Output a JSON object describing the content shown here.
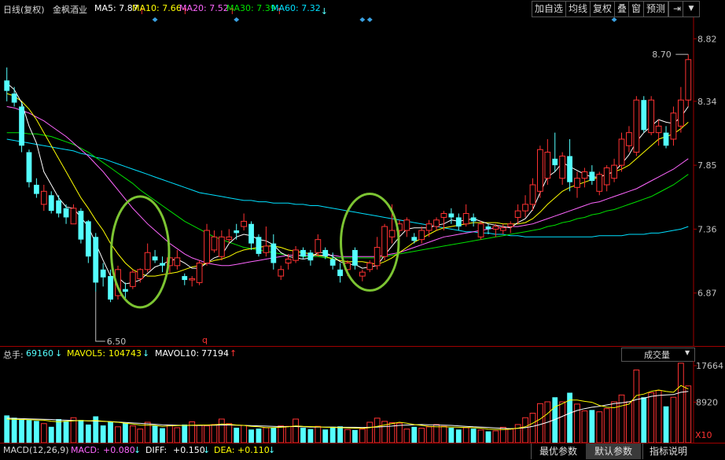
{
  "header": {
    "period": "日线(复权)",
    "stock": "金枫酒业",
    "ma": [
      {
        "label": "MA5",
        "value": "7.87",
        "arrow": "↑",
        "color": "#ffffff"
      },
      {
        "label": "MA10",
        "value": "7.66",
        "arrow": "↑",
        "color": "#ffff00"
      },
      {
        "label": "MA20",
        "value": "7.52",
        "arrow": "↑",
        "color": "#ff66ff"
      },
      {
        "label": "MA30",
        "value": "7.39",
        "arrow": "↑",
        "color": "#00e000"
      },
      {
        "label": "MA60",
        "value": "7.32",
        "arrow": "↓",
        "color": "#00e0ff"
      }
    ]
  },
  "toolbar": {
    "add_stock": "加自选",
    "ma_line": "均线",
    "restore": "复权",
    "overlay": "叠",
    "window": "窗",
    "alert": "预测",
    "exit_icon": "exit-icon",
    "menu_icon": "dropdown-icon"
  },
  "price_axis": {
    "ticks": [
      "8.82",
      "8.34",
      "7.85",
      "7.36",
      "6.87"
    ]
  },
  "annotations": {
    "high_label": "8.70",
    "low_label": "6.50",
    "q_marker": "q"
  },
  "volume_header": {
    "total_label": "总手:",
    "total_value": "69160",
    "total_arrow": "↓",
    "mavol5_label": "MAVOL5:",
    "mavol5_value": "104743",
    "mavol5_arrow": "↓",
    "mavol10_label": "MAVOL10:",
    "mavol10_value": "77194",
    "mavol10_arrow": "↑",
    "selector": "成交量"
  },
  "volume_axis": {
    "ticks": [
      "17664",
      "8920"
    ],
    "unit": "X10"
  },
  "macd_header": {
    "name": "MACD(12,26,9)",
    "macd_label": "MACD:",
    "macd_value": "+0.080",
    "macd_arrow": "↓",
    "diff_label": "DIFF:",
    "diff_value": "+0.150",
    "diff_arrow": "↓",
    "dea_label": "DEA:",
    "dea_value": "+0.110",
    "dea_arrow": "↓"
  },
  "bottom_buttons": [
    "最优参数",
    "默认参数",
    "指标说明"
  ],
  "colors": {
    "up": "#ff3232",
    "down": "#54ffff",
    "ma5": "#ffffff",
    "ma10": "#ffff00",
    "ma20": "#ff66ff",
    "ma30": "#00e000",
    "ma60": "#00e0ff",
    "circle": "#7cc432"
  },
  "chart_data": {
    "type": "candlestick",
    "ylim": [
      6.5,
      8.9
    ],
    "price_ticks": [
      8.82,
      8.34,
      7.85,
      7.36,
      6.87
    ],
    "candles": [
      [
        8.5,
        8.6,
        8.34,
        8.42
      ],
      [
        8.4,
        8.45,
        8.3,
        8.33
      ],
      [
        8.3,
        8.33,
        7.95,
        8.0
      ],
      [
        7.95,
        7.97,
        7.68,
        7.72
      ],
      [
        7.7,
        7.75,
        7.6,
        7.63
      ],
      [
        7.55,
        7.7,
        7.5,
        7.65
      ],
      [
        7.62,
        7.65,
        7.48,
        7.5
      ],
      [
        7.58,
        7.62,
        7.45,
        7.48
      ],
      [
        7.52,
        7.55,
        7.4,
        7.45
      ],
      [
        7.4,
        7.55,
        7.4,
        7.52
      ],
      [
        7.5,
        7.52,
        7.25,
        7.28
      ],
      [
        7.42,
        7.43,
        7.1,
        7.15
      ],
      [
        7.3,
        7.33,
        6.88,
        6.95
      ],
      [
        7.05,
        7.1,
        6.92,
        6.99
      ],
      [
        7.0,
        7.05,
        6.8,
        6.82
      ],
      [
        6.85,
        7.08,
        6.82,
        7.05
      ],
      [
        6.9,
        6.95,
        6.82,
        6.88
      ],
      [
        6.92,
        7.05,
        6.9,
        7.03
      ],
      [
        6.98,
        7.06,
        6.95,
        7.05
      ],
      [
        7.05,
        7.25,
        7.03,
        7.18
      ],
      [
        7.15,
        7.2,
        7.1,
        7.12
      ],
      [
        7.1,
        7.15,
        7.03,
        7.08
      ],
      [
        7.08,
        7.15,
        7.02,
        7.14
      ],
      [
        7.08,
        7.2,
        7.05,
        7.14
      ],
      [
        7.0,
        7.02,
        6.93,
        6.97
      ],
      [
        6.97,
        7.0,
        6.92,
        6.98
      ],
      [
        6.95,
        7.12,
        6.93,
        7.1
      ],
      [
        7.1,
        7.4,
        7.08,
        7.35
      ],
      [
        7.2,
        7.35,
        7.18,
        7.3
      ],
      [
        7.15,
        7.35,
        7.12,
        7.3
      ],
      [
        7.28,
        7.36,
        7.25,
        7.3
      ],
      [
        7.35,
        7.4,
        7.28,
        7.33
      ],
      [
        7.38,
        7.48,
        7.35,
        7.42
      ],
      [
        7.4,
        7.42,
        7.2,
        7.25
      ],
      [
        7.3,
        7.32,
        7.15,
        7.17
      ],
      [
        7.18,
        7.38,
        7.15,
        7.23
      ],
      [
        7.25,
        7.32,
        7.05,
        7.1
      ],
      [
        7.0,
        7.08,
        6.97,
        7.05
      ],
      [
        7.1,
        7.17,
        7.05,
        7.13
      ],
      [
        7.12,
        7.23,
        7.1,
        7.2
      ],
      [
        7.2,
        7.22,
        7.13,
        7.15
      ],
      [
        7.18,
        7.2,
        7.08,
        7.12
      ],
      [
        7.18,
        7.32,
        7.15,
        7.28
      ],
      [
        7.2,
        7.22,
        7.13,
        7.15
      ],
      [
        7.13,
        7.18,
        7.05,
        7.08
      ],
      [
        7.05,
        7.1,
        6.95,
        7.0
      ],
      [
        7.05,
        7.12,
        7.0,
        7.1
      ],
      [
        7.2,
        7.22,
        7.05,
        7.08
      ],
      [
        7.0,
        7.05,
        6.96,
        7.03
      ],
      [
        7.05,
        7.12,
        7.03,
        7.1
      ],
      [
        7.08,
        7.3,
        7.05,
        7.22
      ],
      [
        7.15,
        7.4,
        7.12,
        7.38
      ],
      [
        7.3,
        7.55,
        7.25,
        7.35
      ],
      [
        7.35,
        7.43,
        7.28,
        7.4
      ],
      [
        7.35,
        7.45,
        7.3,
        7.43
      ],
      [
        7.3,
        7.33,
        7.25,
        7.27
      ],
      [
        7.28,
        7.38,
        7.25,
        7.35
      ],
      [
        7.35,
        7.43,
        7.3,
        7.4
      ],
      [
        7.38,
        7.45,
        7.35,
        7.43
      ],
      [
        7.45,
        7.5,
        7.35,
        7.48
      ],
      [
        7.48,
        7.52,
        7.4,
        7.45
      ],
      [
        7.45,
        7.48,
        7.35,
        7.38
      ],
      [
        7.4,
        7.55,
        7.38,
        7.48
      ],
      [
        7.45,
        7.48,
        7.38,
        7.42
      ],
      [
        7.3,
        7.42,
        7.28,
        7.4
      ],
      [
        7.38,
        7.4,
        7.32,
        7.36
      ],
      [
        7.36,
        7.4,
        7.3,
        7.38
      ],
      [
        7.35,
        7.4,
        7.32,
        7.37
      ],
      [
        7.38,
        7.42,
        7.33,
        7.4
      ],
      [
        7.45,
        7.55,
        7.4,
        7.5
      ],
      [
        7.5,
        7.62,
        7.45,
        7.55
      ],
      [
        7.55,
        7.75,
        7.5,
        7.7
      ],
      [
        7.65,
        8.0,
        7.6,
        7.97
      ],
      [
        7.75,
        8.05,
        7.7,
        7.95
      ],
      [
        7.9,
        8.1,
        7.8,
        7.85
      ],
      [
        7.75,
        7.95,
        7.7,
        7.92
      ],
      [
        7.92,
        8.05,
        7.65,
        7.72
      ],
      [
        7.68,
        7.8,
        7.6,
        7.75
      ],
      [
        7.75,
        7.83,
        7.68,
        7.8
      ],
      [
        7.8,
        7.85,
        7.7,
        7.73
      ],
      [
        7.65,
        7.8,
        7.62,
        7.78
      ],
      [
        7.7,
        7.85,
        7.65,
        7.83
      ],
      [
        7.75,
        7.9,
        7.72,
        7.85
      ],
      [
        7.85,
        8.1,
        7.8,
        8.05
      ],
      [
        8.0,
        8.15,
        7.95,
        8.1
      ],
      [
        7.95,
        8.38,
        7.92,
        8.35
      ],
      [
        8.35,
        8.38,
        8.1,
        8.12
      ],
      [
        8.1,
        8.38,
        8.08,
        8.35
      ],
      [
        8.1,
        8.2,
        8.0,
        8.15
      ],
      [
        8.1,
        8.15,
        7.98,
        8.0
      ],
      [
        8.05,
        8.3,
        8.0,
        8.25
      ],
      [
        8.15,
        8.45,
        8.1,
        8.35
      ],
      [
        8.35,
        8.7,
        8.3,
        8.66
      ]
    ],
    "ma5": [
      8.48,
      8.43,
      8.33,
      8.15,
      8.02,
      7.8,
      7.7,
      7.6,
      7.53,
      7.52,
      7.45,
      7.38,
      7.25,
      7.12,
      7.0,
      6.99,
      6.94,
      6.95,
      6.97,
      7.02,
      7.07,
      7.09,
      7.12,
      7.13,
      7.1,
      7.06,
      7.06,
      7.1,
      7.14,
      7.16,
      7.25,
      7.3,
      7.32,
      7.31,
      7.28,
      7.27,
      7.24,
      7.18,
      7.15,
      7.14,
      7.13,
      7.14,
      7.18,
      7.18,
      7.15,
      7.11,
      7.09,
      7.09,
      7.06,
      7.07,
      7.08,
      7.16,
      7.23,
      7.3,
      7.36,
      7.37,
      7.37,
      7.37,
      7.39,
      7.4,
      7.43,
      7.42,
      7.43,
      7.44,
      7.42,
      7.4,
      7.39,
      7.38,
      7.37,
      7.41,
      7.44,
      7.51,
      7.64,
      7.76,
      7.8,
      7.87,
      7.84,
      7.81,
      7.78,
      7.76,
      7.76,
      7.78,
      7.8,
      7.86,
      7.93,
      8.03,
      8.1,
      8.15,
      8.2,
      8.18,
      8.17,
      8.22,
      8.3
    ],
    "ma10": [
      8.4,
      8.38,
      8.34,
      8.28,
      8.2,
      8.1,
      8.0,
      7.9,
      7.8,
      7.7,
      7.6,
      7.52,
      7.43,
      7.35,
      7.25,
      7.17,
      7.1,
      7.05,
      7.02,
      7.0,
      7.0,
      7.01,
      7.02,
      7.03,
      7.05,
      7.07,
      7.08,
      7.1,
      7.12,
      7.13,
      7.15,
      7.18,
      7.2,
      7.21,
      7.22,
      7.23,
      7.23,
      7.22,
      7.2,
      7.19,
      7.18,
      7.17,
      7.16,
      7.15,
      7.13,
      7.12,
      7.11,
      7.11,
      7.11,
      7.1,
      7.09,
      7.11,
      7.14,
      7.18,
      7.22,
      7.26,
      7.29,
      7.32,
      7.35,
      7.37,
      7.38,
      7.39,
      7.4,
      7.41,
      7.41,
      7.41,
      7.41,
      7.4,
      7.4,
      7.4,
      7.41,
      7.44,
      7.49,
      7.55,
      7.6,
      7.65,
      7.68,
      7.7,
      7.72,
      7.74,
      7.76,
      7.78,
      7.8,
      7.82,
      7.85,
      7.9,
      7.95,
      8.0,
      8.05,
      8.07,
      8.09,
      8.13,
      8.18
    ],
    "ma20": [
      8.3,
      8.29,
      8.27,
      8.25,
      8.22,
      8.19,
      8.15,
      8.11,
      8.07,
      8.02,
      7.97,
      7.92,
      7.86,
      7.8,
      7.73,
      7.66,
      7.59,
      7.52,
      7.46,
      7.4,
      7.35,
      7.3,
      7.25,
      7.21,
      7.17,
      7.14,
      7.12,
      7.1,
      7.09,
      7.08,
      7.08,
      7.09,
      7.1,
      7.11,
      7.12,
      7.13,
      7.14,
      7.15,
      7.16,
      7.16,
      7.16,
      7.16,
      7.16,
      7.16,
      7.16,
      7.15,
      7.15,
      7.15,
      7.15,
      7.15,
      7.15,
      7.16,
      7.17,
      7.18,
      7.2,
      7.22,
      7.24,
      7.26,
      7.28,
      7.3,
      7.31,
      7.32,
      7.33,
      7.34,
      7.35,
      7.36,
      7.37,
      7.37,
      7.38,
      7.38,
      7.39,
      7.4,
      7.42,
      7.44,
      7.46,
      7.48,
      7.5,
      7.52,
      7.54,
      7.56,
      7.57,
      7.59,
      7.61,
      7.63,
      7.65,
      7.67,
      7.7,
      7.73,
      7.76,
      7.79,
      7.82,
      7.86,
      7.9
    ],
    "ma30": [
      8.1,
      8.1,
      8.1,
      8.09,
      8.09,
      8.08,
      8.07,
      8.05,
      8.03,
      8.01,
      7.98,
      7.95,
      7.91,
      7.87,
      7.83,
      7.79,
      7.75,
      7.71,
      7.66,
      7.62,
      7.58,
      7.54,
      7.5,
      7.46,
      7.42,
      7.39,
      7.36,
      7.33,
      7.3,
      7.28,
      7.26,
      7.24,
      7.22,
      7.21,
      7.2,
      7.19,
      7.18,
      7.17,
      7.16,
      7.16,
      7.15,
      7.15,
      7.15,
      7.14,
      7.14,
      7.14,
      7.14,
      7.14,
      7.14,
      7.14,
      7.14,
      7.15,
      7.16,
      7.17,
      7.18,
      7.19,
      7.2,
      7.21,
      7.22,
      7.23,
      7.24,
      7.25,
      7.26,
      7.27,
      7.28,
      7.29,
      7.3,
      7.31,
      7.32,
      7.33,
      7.34,
      7.35,
      7.36,
      7.38,
      7.39,
      7.41,
      7.42,
      7.44,
      7.45,
      7.47,
      7.48,
      7.5,
      7.51,
      7.53,
      7.55,
      7.57,
      7.59,
      7.61,
      7.64,
      7.67,
      7.7,
      7.74,
      7.78
    ],
    "ma60": [
      8.05,
      8.04,
      8.03,
      8.02,
      8.01,
      8.0,
      7.99,
      7.98,
      7.97,
      7.96,
      7.94,
      7.93,
      7.91,
      7.9,
      7.88,
      7.86,
      7.84,
      7.82,
      7.8,
      7.78,
      7.76,
      7.74,
      7.72,
      7.7,
      7.68,
      7.66,
      7.64,
      7.63,
      7.62,
      7.61,
      7.6,
      7.59,
      7.58,
      7.58,
      7.57,
      7.57,
      7.56,
      7.56,
      7.56,
      7.55,
      7.55,
      7.54,
      7.54,
      7.53,
      7.52,
      7.51,
      7.5,
      7.49,
      7.48,
      7.47,
      7.46,
      7.45,
      7.44,
      7.43,
      7.42,
      7.41,
      7.4,
      7.39,
      7.38,
      7.37,
      7.36,
      7.35,
      7.34,
      7.34,
      7.33,
      7.33,
      7.32,
      7.32,
      7.31,
      7.31,
      7.3,
      7.3,
      7.3,
      7.3,
      7.3,
      7.3,
      7.3,
      7.3,
      7.3,
      7.3,
      7.31,
      7.31,
      7.31,
      7.31,
      7.32,
      7.32,
      7.32,
      7.33,
      7.33,
      7.34,
      7.35,
      7.36,
      7.38
    ],
    "volume": {
      "ylim": [
        0,
        18000
      ],
      "ticks": [
        17664,
        8920
      ],
      "values": [
        6000,
        5500,
        5200,
        5000,
        4800,
        4200,
        3500,
        5200,
        4800,
        5500,
        5000,
        4000,
        5800,
        3800,
        4600,
        3500,
        4300,
        3700,
        3000,
        4500,
        3800,
        3200,
        3900,
        3300,
        4000,
        4600,
        3800,
        3700,
        4000,
        5200,
        4200,
        3300,
        3800,
        2900,
        3100,
        3300,
        3300,
        3700,
        3600,
        5200,
        3300,
        3000,
        3600,
        2900,
        3500,
        3600,
        2900,
        2800,
        3000,
        4500,
        5400,
        4700,
        4400,
        4300,
        3000,
        3500,
        3200,
        3500,
        4000,
        3600,
        3300,
        2900,
        3300,
        3100,
        2800,
        2500,
        2600,
        3400,
        3000,
        4000,
        5500,
        6500,
        8600,
        9000,
        10000,
        9000,
        11000,
        8500,
        7000,
        7200,
        6800,
        7500,
        9000,
        10500,
        9000,
        16000,
        10000,
        11000,
        11500,
        8000,
        10000,
        17500,
        12500
      ],
      "mavol5": [
        5200,
        5150,
        5100,
        5050,
        5000,
        4950,
        4700,
        4600,
        4700,
        4800,
        4900,
        4800,
        4900,
        4700,
        4600,
        4500,
        4300,
        4100,
        3900,
        3850,
        3800,
        3600,
        3700,
        3750,
        3800,
        3850,
        3900,
        3900,
        3950,
        4100,
        4050,
        3900,
        3800,
        3600,
        3500,
        3300,
        3300,
        3400,
        3500,
        3700,
        3600,
        3550,
        3500,
        3400,
        3350,
        3300,
        3250,
        3200,
        3150,
        3300,
        3600,
        3900,
        4200,
        4500,
        4300,
        4000,
        3800,
        3600,
        3500,
        3500,
        3450,
        3400,
        3350,
        3300,
        3200,
        3000,
        2900,
        2900,
        3000,
        3200,
        3500,
        4300,
        5200,
        6400,
        7900,
        8600,
        9400,
        9400,
        9100,
        8900,
        8200,
        7800,
        7700,
        8100,
        8500,
        10400,
        10700,
        11300,
        11600,
        11300,
        11100,
        12600,
        11800
      ],
      "mavol10": [
        5400,
        5350,
        5300,
        5250,
        5200,
        5150,
        5100,
        5000,
        4950,
        4900,
        4850,
        4800,
        4750,
        4700,
        4650,
        4550,
        4450,
        4350,
        4250,
        4150,
        4050,
        3950,
        3900,
        3850,
        3800,
        3800,
        3800,
        3850,
        3850,
        3900,
        3900,
        3850,
        3800,
        3750,
        3700,
        3650,
        3600,
        3550,
        3550,
        3550,
        3500,
        3450,
        3450,
        3450,
        3450,
        3400,
        3400,
        3400,
        3350,
        3400,
        3450,
        3550,
        3650,
        3800,
        3900,
        3950,
        4000,
        3950,
        3900,
        3850,
        3800,
        3700,
        3600,
        3500,
        3450,
        3350,
        3250,
        3150,
        3100,
        3150,
        3300,
        3600,
        4000,
        4500,
        5100,
        5800,
        6500,
        7100,
        7500,
        7800,
        8000,
        8300,
        8600,
        8800,
        9000,
        9500,
        9800,
        10200,
        10400,
        10500,
        10600,
        11100,
        11300
      ]
    }
  }
}
